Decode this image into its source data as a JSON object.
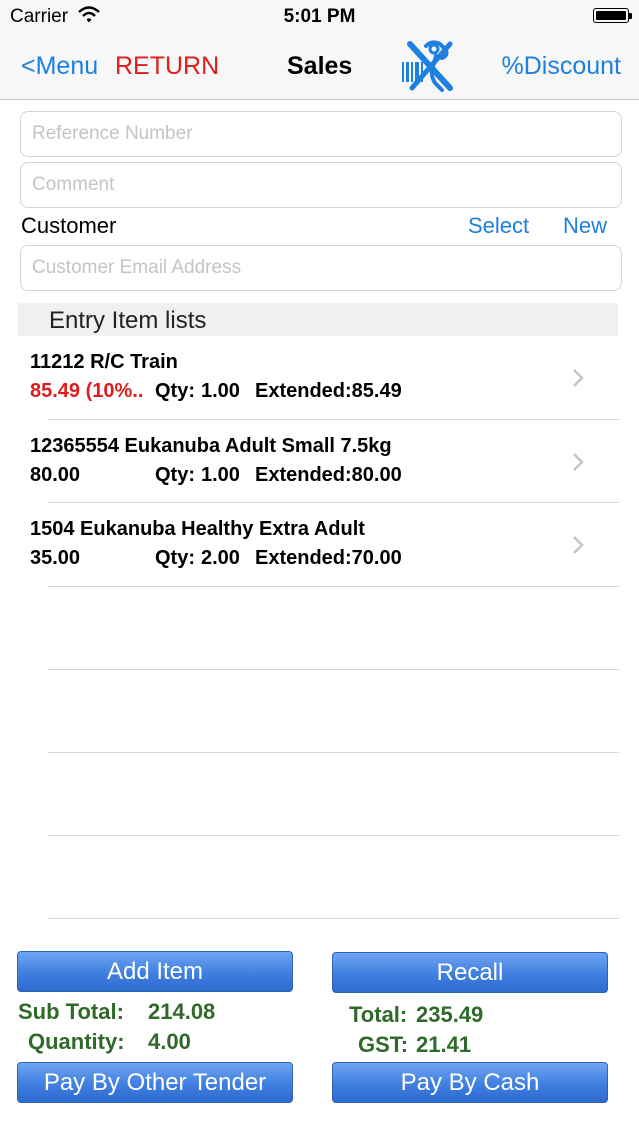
{
  "status_bar": {
    "carrier": "Carrier",
    "time": "5:01 PM"
  },
  "nav": {
    "back_label": "<Menu",
    "return_label": "RETURN",
    "title": "Sales",
    "discount_label": "%Discount",
    "scanner_icon": "barcode-scanner-off-icon"
  },
  "form": {
    "reference_placeholder": "Reference Number",
    "comment_placeholder": "Comment",
    "customer_label": "Customer",
    "select_label": "Select",
    "new_label": "New",
    "email_placeholder": "Customer Email Address"
  },
  "list": {
    "header": "Entry Item lists",
    "items": [
      {
        "name": "11212 R/C Train",
        "price": "85.49 (10%..",
        "qty_label": "Qty:",
        "qty": "1.00",
        "extended": "Extended:85.49",
        "price_color": "#e01c1c"
      },
      {
        "name": "12365554 Eukanuba Adult Small 7.5kg",
        "price": "80.00",
        "qty_label": "Qty:",
        "qty": "1.00",
        "extended": "Extended:80.00",
        "price_color": "#000000"
      },
      {
        "name": "1504 Eukanuba Healthy Extra Adult",
        "price": "35.00",
        "qty_label": "Qty:",
        "qty": "2.00",
        "extended": "Extended:70.00",
        "price_color": "#000000"
      }
    ]
  },
  "actions": {
    "add_item": "Add Item",
    "recall": "Recall",
    "pay_other": "Pay By Other Tender",
    "pay_cash": "Pay By Cash"
  },
  "summary": {
    "sub_total_label": "Sub Total:",
    "sub_total_value": "214.08",
    "quantity_label": "Quantity:",
    "quantity_value": "4.00",
    "total_label": "Total:",
    "total_value": "235.49",
    "gst_label": "GST:",
    "gst_value": "21.41"
  },
  "colors": {
    "link": "#1d7fe0",
    "return": "#e01c1c",
    "summary_green": "#2f6a2a",
    "button_blue": "#3f7fdf"
  }
}
